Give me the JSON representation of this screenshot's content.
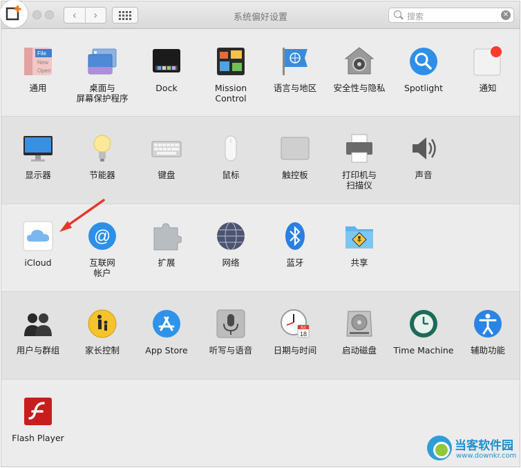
{
  "window": {
    "title": "系统偏好设置",
    "search_placeholder": "搜索",
    "nav_back": "‹",
    "nav_forward": "›"
  },
  "rows": [
    [
      {
        "id": "general",
        "label": "通用",
        "icon": "general-icon"
      },
      {
        "id": "desktop",
        "label": "桌面与\n屏幕保护程序",
        "icon": "desktop-screensaver-icon"
      },
      {
        "id": "dock",
        "label": "Dock",
        "icon": "dock-icon"
      },
      {
        "id": "mission-control",
        "label": "Mission\nControl",
        "icon": "mission-control-icon"
      },
      {
        "id": "language",
        "label": "语言与地区",
        "icon": "language-region-icon"
      },
      {
        "id": "security",
        "label": "安全性与隐私",
        "icon": "security-privacy-icon"
      },
      {
        "id": "spotlight",
        "label": "Spotlight",
        "icon": "spotlight-icon"
      },
      {
        "id": "notifications",
        "label": "通知",
        "icon": "notifications-icon"
      }
    ],
    [
      {
        "id": "displays",
        "label": "显示器",
        "icon": "displays-icon"
      },
      {
        "id": "energy",
        "label": "节能器",
        "icon": "energy-saver-icon"
      },
      {
        "id": "keyboard",
        "label": "键盘",
        "icon": "keyboard-icon"
      },
      {
        "id": "mouse",
        "label": "鼠标",
        "icon": "mouse-icon"
      },
      {
        "id": "trackpad",
        "label": "触控板",
        "icon": "trackpad-icon"
      },
      {
        "id": "printers",
        "label": "打印机与\n扫描仪",
        "icon": "printer-icon"
      },
      {
        "id": "sound",
        "label": "声音",
        "icon": "sound-icon"
      }
    ],
    [
      {
        "id": "icloud",
        "label": "iCloud",
        "icon": "icloud-icon"
      },
      {
        "id": "internet-accounts",
        "label": "互联网\n帐户",
        "icon": "internet-accounts-icon"
      },
      {
        "id": "extensions",
        "label": "扩展",
        "icon": "extensions-icon"
      },
      {
        "id": "network",
        "label": "网络",
        "icon": "network-icon"
      },
      {
        "id": "bluetooth",
        "label": "蓝牙",
        "icon": "bluetooth-icon"
      },
      {
        "id": "sharing",
        "label": "共享",
        "icon": "sharing-icon"
      }
    ],
    [
      {
        "id": "users",
        "label": "用户与群组",
        "icon": "users-groups-icon"
      },
      {
        "id": "parental",
        "label": "家长控制",
        "icon": "parental-controls-icon"
      },
      {
        "id": "app-store",
        "label": "App Store",
        "icon": "app-store-icon"
      },
      {
        "id": "dictation",
        "label": "听写与语音",
        "icon": "dictation-speech-icon"
      },
      {
        "id": "date-time",
        "label": "日期与时间",
        "icon": "date-time-icon"
      },
      {
        "id": "startup-disk",
        "label": "启动磁盘",
        "icon": "startup-disk-icon"
      },
      {
        "id": "time-machine",
        "label": "Time Machine",
        "icon": "time-machine-icon"
      },
      {
        "id": "accessibility",
        "label": "辅助功能",
        "icon": "accessibility-icon"
      }
    ],
    [
      {
        "id": "flash",
        "label": "Flash Player",
        "icon": "flash-player-icon"
      }
    ]
  ],
  "icon_texts": {
    "general_file": "File",
    "general_new": "New",
    "general_open": "Open",
    "calendar_month": "JUL",
    "calendar_day": "18",
    "internet_at": "@"
  },
  "watermark": {
    "title": "当客软件园",
    "url": "www.downkr.com"
  },
  "colors": {
    "accent_blue": "#1f7fe0",
    "arrow_red": "#e6372a",
    "notification_red": "#ff3b30"
  }
}
